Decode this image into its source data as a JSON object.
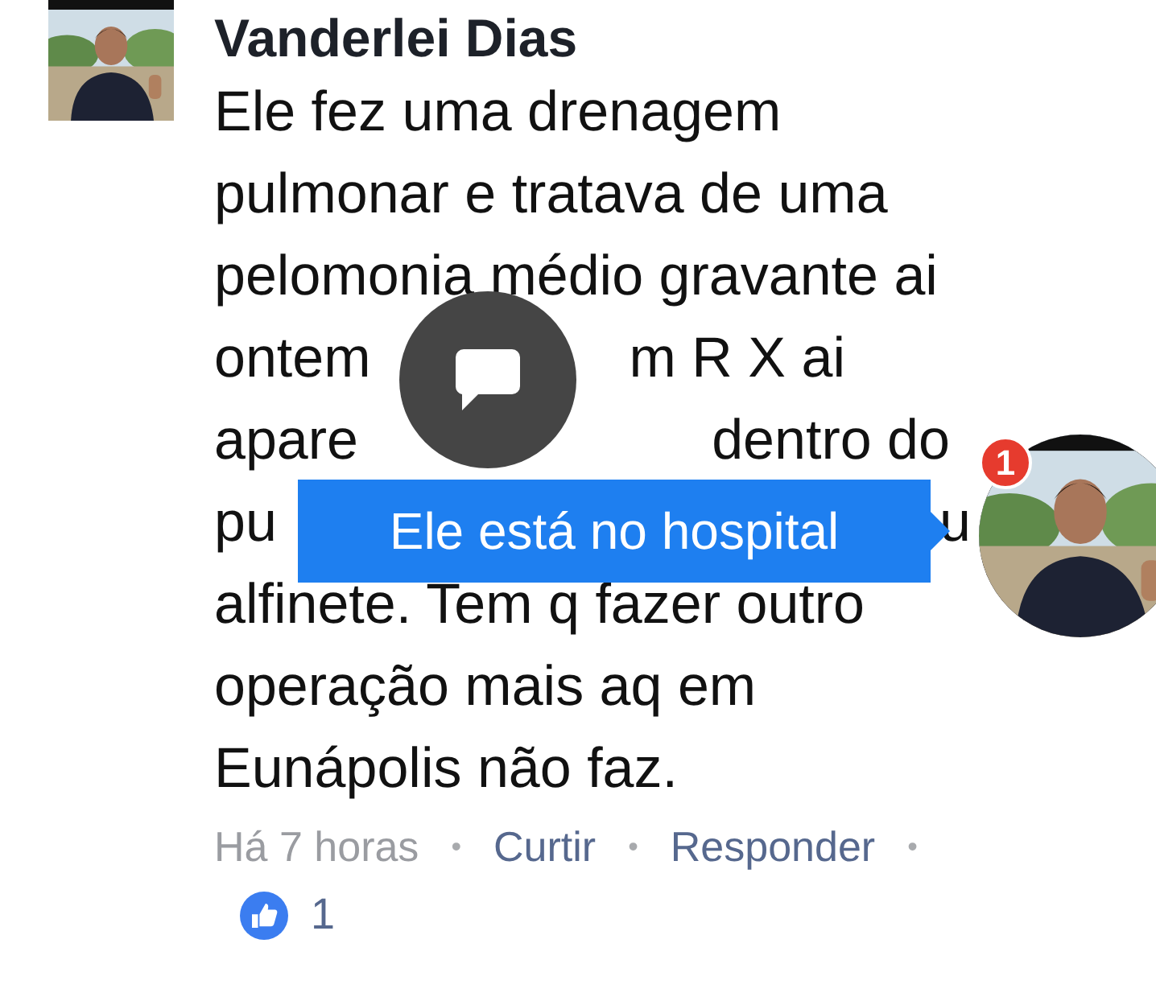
{
  "comment": {
    "author": "Vanderlei Dias",
    "lines": [
      [
        "Ele fez uma drenagem"
      ],
      [
        "pulmonar e tratava de uma"
      ],
      [
        "pelomonia médio gravante ai"
      ],
      [
        "ontem",
        "m R X ai"
      ],
      [
        "apare",
        "dentro do"
      ],
      [
        "pu",
        "u"
      ],
      [
        "alfinete. Tem q fazer outro"
      ],
      [
        "operação mais aq em"
      ],
      [
        "Eunápolis não faz."
      ]
    ],
    "meta": [
      {
        "kind": "time",
        "text": "Há 7 horas"
      },
      {
        "kind": "dot",
        "text": "•"
      },
      {
        "kind": "link",
        "text": "Curtir"
      },
      {
        "kind": "dot",
        "text": "•"
      },
      {
        "kind": "link",
        "text": "Responder"
      },
      {
        "kind": "dot",
        "text": "•"
      }
    ],
    "likes": "1"
  },
  "chat_bubble": {
    "kind": "message"
  },
  "tooltip": "Ele está no hospital",
  "chat_head": {
    "badge": "1"
  }
}
